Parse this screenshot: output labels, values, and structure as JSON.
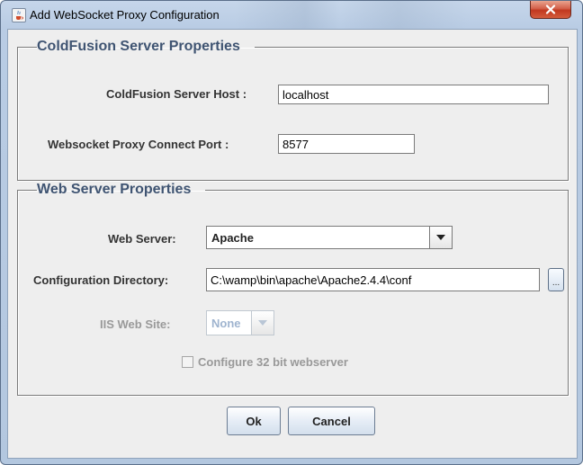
{
  "window": {
    "title": "Add WebSocket Proxy Configuration",
    "close_glyph": "✕",
    "app_icon": "java-cup-icon"
  },
  "server_group": {
    "legend": "ColdFusion Server Properties",
    "host_label": "ColdFusion Server Host :",
    "host_value": "localhost",
    "port_label": "Websocket Proxy Connect Port :",
    "port_value": "8577"
  },
  "web_group": {
    "legend": "Web Server Properties",
    "web_server_label": "Web Server:",
    "web_server_value": "Apache",
    "config_dir_label": "Configuration Directory:",
    "config_dir_value": "C:\\wamp\\bin\\apache\\Apache2.4.4\\conf",
    "browse_label": "...",
    "iis_site_label": "IIS Web Site:",
    "iis_site_value": "None",
    "checkbox_label": "Configure 32 bit webserver",
    "checkbox_checked": false
  },
  "buttons": {
    "ok": "Ok",
    "cancel": "Cancel"
  }
}
